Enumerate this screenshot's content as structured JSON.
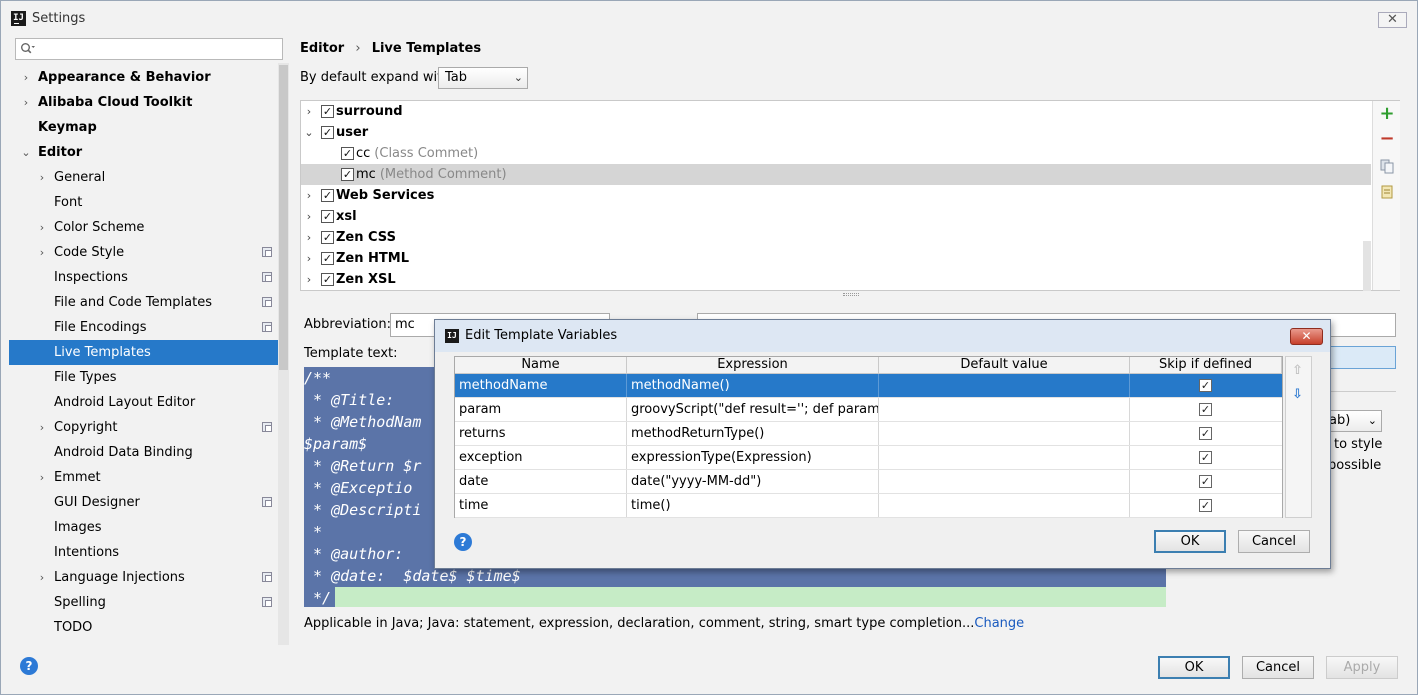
{
  "window": {
    "title": "Settings",
    "app_icon": "IJ"
  },
  "search": {
    "placeholder": ""
  },
  "sidebar": {
    "items": [
      {
        "label": "Appearance & Behavior",
        "arrow": "›",
        "bold": true
      },
      {
        "label": "Alibaba Cloud Toolkit",
        "arrow": "›",
        "bold": true
      },
      {
        "label": "Keymap",
        "arrow": "",
        "bold": true
      },
      {
        "label": "Editor",
        "arrow": "⌄",
        "bold": true
      },
      {
        "label": "General",
        "arrow": "›"
      },
      {
        "label": "Font",
        "arrow": ""
      },
      {
        "label": "Color Scheme",
        "arrow": "›"
      },
      {
        "label": "Code Style",
        "arrow": "›",
        "copy": true
      },
      {
        "label": "Inspections",
        "arrow": "",
        "copy": true
      },
      {
        "label": "File and Code Templates",
        "arrow": "",
        "copy": true
      },
      {
        "label": "File Encodings",
        "arrow": "",
        "copy": true
      },
      {
        "label": "Live Templates",
        "arrow": "",
        "selected": true
      },
      {
        "label": "File Types",
        "arrow": ""
      },
      {
        "label": "Android Layout Editor",
        "arrow": ""
      },
      {
        "label": "Copyright",
        "arrow": "›",
        "copy": true
      },
      {
        "label": "Android Data Binding",
        "arrow": ""
      },
      {
        "label": "Emmet",
        "arrow": "›"
      },
      {
        "label": "GUI Designer",
        "arrow": "",
        "copy": true
      },
      {
        "label": "Images",
        "arrow": ""
      },
      {
        "label": "Intentions",
        "arrow": ""
      },
      {
        "label": "Language Injections",
        "arrow": "›",
        "copy": true
      },
      {
        "label": "Spelling",
        "arrow": "",
        "copy": true
      },
      {
        "label": "TODO",
        "arrow": ""
      }
    ]
  },
  "breadcrumb": {
    "part1": "Editor",
    "sep": "›",
    "part2": "Live Templates"
  },
  "expand": {
    "label": "By default expand with",
    "value": "Tab",
    "chev": "⌄"
  },
  "templates": {
    "rows": [
      {
        "name": "surround",
        "group": true,
        "arrow": "›",
        "checked": true
      },
      {
        "name": "user",
        "group": true,
        "arrow": "⌄",
        "checked": true
      },
      {
        "name": "cc",
        "desc": "(Class Commet)",
        "group": false,
        "checked": true
      },
      {
        "name": "mc",
        "desc": "(Method Comment)",
        "group": false,
        "checked": true,
        "selected": true
      },
      {
        "name": "Web Services",
        "group": true,
        "arrow": "›",
        "checked": true
      },
      {
        "name": "xsl",
        "group": true,
        "arrow": "›",
        "checked": true
      },
      {
        "name": "Zen CSS",
        "group": true,
        "arrow": "›",
        "checked": true
      },
      {
        "name": "Zen HTML",
        "group": true,
        "arrow": "›",
        "checked": true
      },
      {
        "name": "Zen XSL",
        "group": true,
        "arrow": "›",
        "checked": true
      }
    ],
    "check_glyph": "✓",
    "add": "+",
    "remove": "−"
  },
  "abbreviation": {
    "label": "Abbreviation:",
    "value": "mc"
  },
  "template_text": {
    "label": "Template text:",
    "lines": [
      "/**",
      " * @Title:",
      " * @MethodNam",
      "$param$",
      " * @Return $r",
      " * @Exceptio",
      " * @Descripti",
      " *",
      " * @author: ",
      " * @date:  $date$ $time$",
      " */"
    ]
  },
  "options": {
    "expand_value": "ab)",
    "line1": "to style",
    "line2": "possible"
  },
  "applicable": {
    "text": "Applicable in Java; Java: statement, expression, declaration, comment, string, smart type completion...",
    "link": "Change"
  },
  "footer": {
    "help": "?",
    "ok": "OK",
    "cancel": "Cancel",
    "apply": "Apply"
  },
  "dialog": {
    "title": "Edit Template Variables",
    "close": "✕",
    "columns": [
      "Name",
      "Expression",
      "Default value",
      "Skip if defined"
    ],
    "rows": [
      {
        "name": "methodName",
        "expression": "methodName()",
        "default": "",
        "skip": true
      },
      {
        "name": "param",
        "expression": "groovyScript(\"def result=''; def params...",
        "default": "",
        "skip": true
      },
      {
        "name": "returns",
        "expression": "methodReturnType()",
        "default": "",
        "skip": true
      },
      {
        "name": "exception",
        "expression": "expressionType(Expression)",
        "default": "",
        "skip": true
      },
      {
        "name": "date",
        "expression": "date(\"yyyy-MM-dd\")",
        "default": "",
        "skip": true
      },
      {
        "name": "time",
        "expression": "time()",
        "default": "",
        "skip": true
      }
    ],
    "ok": "OK",
    "cancel": "Cancel",
    "help": "?",
    "up": "⇧",
    "down": "⇩"
  }
}
